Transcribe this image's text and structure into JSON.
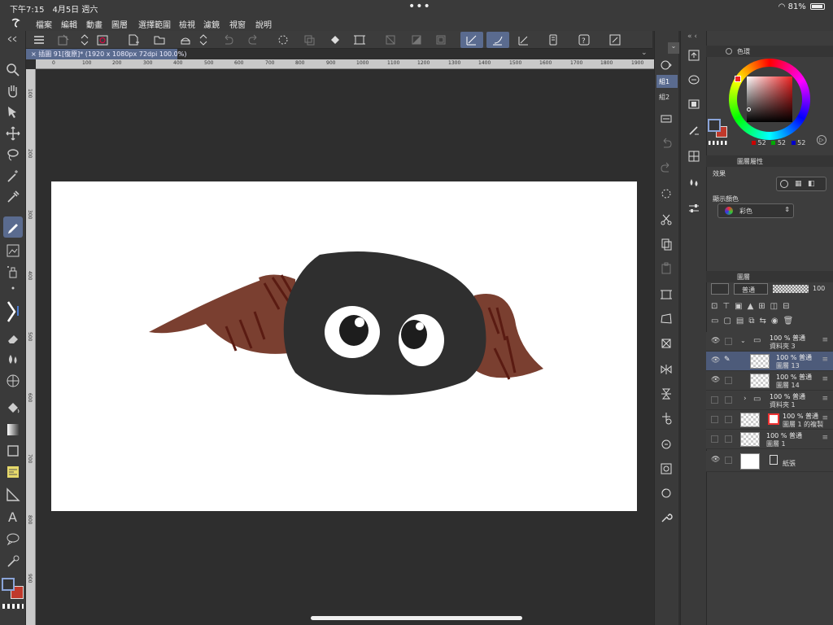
{
  "status_bar": {
    "time": "下午7:15　4月5日 週六",
    "dots": "•••",
    "battery": "81%"
  },
  "menu": [
    "檔案",
    "編輯",
    "動畫",
    "圖層",
    "選擇範圍",
    "檢視",
    "濾鏡",
    "視窗",
    "說明"
  ],
  "document_tab": {
    "title": "插圖 91[復原]* (1920 x 1080px 72dpi 100.0%)"
  },
  "ruler_top": [
    "0",
    "100",
    "200",
    "300",
    "400",
    "500",
    "600",
    "700",
    "800",
    "900",
    "1000",
    "1100",
    "1200",
    "1300",
    "1400",
    "1500",
    "1600",
    "1700",
    "1800",
    "1900"
  ],
  "ruler_left": [
    "100",
    "200",
    "300",
    "400",
    "500",
    "600",
    "700",
    "800",
    "900",
    "1000"
  ],
  "side_tabs": [
    "組1",
    "組2"
  ],
  "color_panel": {
    "title": "色環",
    "rgb": [
      "52",
      "52",
      "52"
    ]
  },
  "layer_property": {
    "title": "圖層屬性",
    "effect_label": "效果",
    "display_color_label": "顯示顏色",
    "display_color_value": "彩色"
  },
  "layer_panel": {
    "title": "圖層",
    "blend_mode": "普通",
    "opacity": "100",
    "layers": [
      {
        "line1": "100 % 普通",
        "line2": "資料夾 3"
      },
      {
        "line1": "100 % 普通",
        "line2": "圖層 13"
      },
      {
        "line1": "100 % 普通",
        "line2": "圖層 14"
      },
      {
        "line1": "100 % 普通",
        "line2": "資料夾 1"
      },
      {
        "line1": "100 % 普通",
        "line2": "圖層 1 的複製"
      },
      {
        "line1": "100 % 普通",
        "line2": "圖層 1"
      },
      {
        "line1": "",
        "line2": "紙張"
      }
    ]
  },
  "colors": {
    "accent": "#5a6b8f",
    "creature_body": "#2f2f2f",
    "horn": "#7a3f30",
    "horn_stripe": "#5a1b12",
    "main_color": "#343434",
    "sub_color": "#c0392b"
  }
}
